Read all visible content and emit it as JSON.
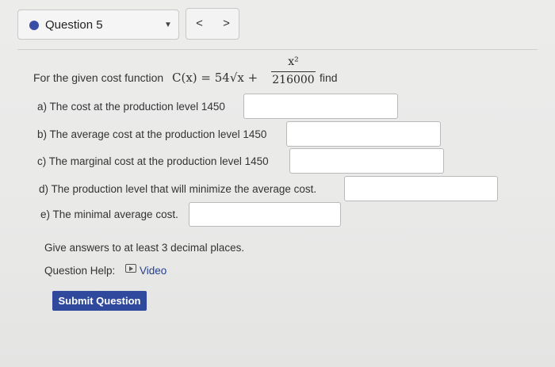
{
  "header": {
    "question_label": "Question 5",
    "prev_label": "<",
    "next_label": ">"
  },
  "question": {
    "intro": "For the given cost function",
    "formula_lhs": "C(x) = 54√x +",
    "fraction_numerator": "x²",
    "fraction_denominator": "216000",
    "find": "find",
    "parts": [
      {
        "label": "a) The cost at the production level 1450",
        "value": ""
      },
      {
        "label": "b) The average cost at the production level 1450",
        "value": ""
      },
      {
        "label": "c) The marginal cost at the production level 1450",
        "value": ""
      },
      {
        "label": "d) The production level that will minimize the average cost.",
        "value": ""
      },
      {
        "label": "e) The minimal average cost.",
        "value": ""
      }
    ]
  },
  "note": "Give answers to at least 3 decimal places.",
  "help": {
    "label": "Question Help:",
    "video_label": "Video"
  },
  "submit_label": "Submit Question",
  "colors": {
    "accent": "#2f4a9c",
    "dot": "#3a4ea8"
  },
  "icons": {
    "question_status": "status-dot-icon",
    "dropdown": "caret-down-icon",
    "video": "video-icon"
  }
}
